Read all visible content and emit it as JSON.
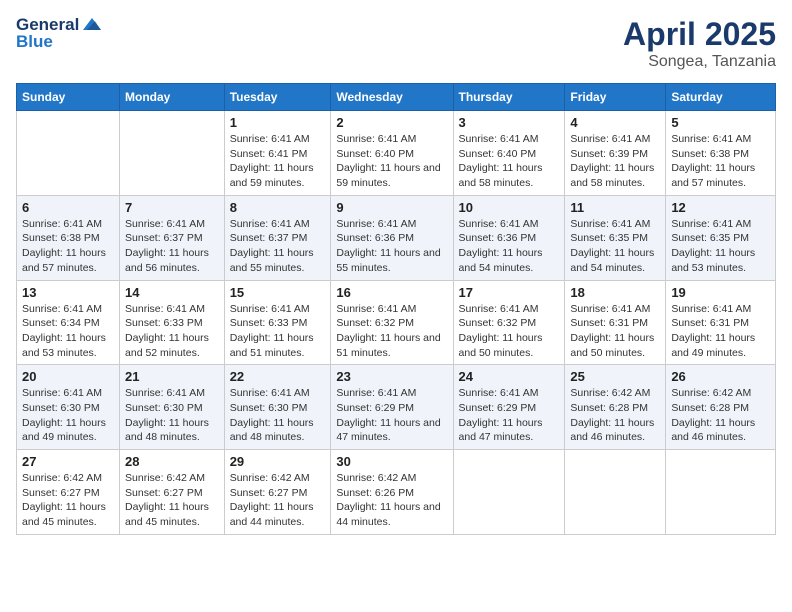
{
  "header": {
    "logo_general": "General",
    "logo_blue": "Blue",
    "title": "April 2025",
    "subtitle": "Songea, Tanzania"
  },
  "days_of_week": [
    "Sunday",
    "Monday",
    "Tuesday",
    "Wednesday",
    "Thursday",
    "Friday",
    "Saturday"
  ],
  "weeks": [
    [
      {
        "day": "",
        "info": ""
      },
      {
        "day": "",
        "info": ""
      },
      {
        "day": "1",
        "info": "Sunrise: 6:41 AM\nSunset: 6:41 PM\nDaylight: 11 hours and 59 minutes."
      },
      {
        "day": "2",
        "info": "Sunrise: 6:41 AM\nSunset: 6:40 PM\nDaylight: 11 hours and 59 minutes."
      },
      {
        "day": "3",
        "info": "Sunrise: 6:41 AM\nSunset: 6:40 PM\nDaylight: 11 hours and 58 minutes."
      },
      {
        "day": "4",
        "info": "Sunrise: 6:41 AM\nSunset: 6:39 PM\nDaylight: 11 hours and 58 minutes."
      },
      {
        "day": "5",
        "info": "Sunrise: 6:41 AM\nSunset: 6:38 PM\nDaylight: 11 hours and 57 minutes."
      }
    ],
    [
      {
        "day": "6",
        "info": "Sunrise: 6:41 AM\nSunset: 6:38 PM\nDaylight: 11 hours and 57 minutes."
      },
      {
        "day": "7",
        "info": "Sunrise: 6:41 AM\nSunset: 6:37 PM\nDaylight: 11 hours and 56 minutes."
      },
      {
        "day": "8",
        "info": "Sunrise: 6:41 AM\nSunset: 6:37 PM\nDaylight: 11 hours and 55 minutes."
      },
      {
        "day": "9",
        "info": "Sunrise: 6:41 AM\nSunset: 6:36 PM\nDaylight: 11 hours and 55 minutes."
      },
      {
        "day": "10",
        "info": "Sunrise: 6:41 AM\nSunset: 6:36 PM\nDaylight: 11 hours and 54 minutes."
      },
      {
        "day": "11",
        "info": "Sunrise: 6:41 AM\nSunset: 6:35 PM\nDaylight: 11 hours and 54 minutes."
      },
      {
        "day": "12",
        "info": "Sunrise: 6:41 AM\nSunset: 6:35 PM\nDaylight: 11 hours and 53 minutes."
      }
    ],
    [
      {
        "day": "13",
        "info": "Sunrise: 6:41 AM\nSunset: 6:34 PM\nDaylight: 11 hours and 53 minutes."
      },
      {
        "day": "14",
        "info": "Sunrise: 6:41 AM\nSunset: 6:33 PM\nDaylight: 11 hours and 52 minutes."
      },
      {
        "day": "15",
        "info": "Sunrise: 6:41 AM\nSunset: 6:33 PM\nDaylight: 11 hours and 51 minutes."
      },
      {
        "day": "16",
        "info": "Sunrise: 6:41 AM\nSunset: 6:32 PM\nDaylight: 11 hours and 51 minutes."
      },
      {
        "day": "17",
        "info": "Sunrise: 6:41 AM\nSunset: 6:32 PM\nDaylight: 11 hours and 50 minutes."
      },
      {
        "day": "18",
        "info": "Sunrise: 6:41 AM\nSunset: 6:31 PM\nDaylight: 11 hours and 50 minutes."
      },
      {
        "day": "19",
        "info": "Sunrise: 6:41 AM\nSunset: 6:31 PM\nDaylight: 11 hours and 49 minutes."
      }
    ],
    [
      {
        "day": "20",
        "info": "Sunrise: 6:41 AM\nSunset: 6:30 PM\nDaylight: 11 hours and 49 minutes."
      },
      {
        "day": "21",
        "info": "Sunrise: 6:41 AM\nSunset: 6:30 PM\nDaylight: 11 hours and 48 minutes."
      },
      {
        "day": "22",
        "info": "Sunrise: 6:41 AM\nSunset: 6:30 PM\nDaylight: 11 hours and 48 minutes."
      },
      {
        "day": "23",
        "info": "Sunrise: 6:41 AM\nSunset: 6:29 PM\nDaylight: 11 hours and 47 minutes."
      },
      {
        "day": "24",
        "info": "Sunrise: 6:41 AM\nSunset: 6:29 PM\nDaylight: 11 hours and 47 minutes."
      },
      {
        "day": "25",
        "info": "Sunrise: 6:42 AM\nSunset: 6:28 PM\nDaylight: 11 hours and 46 minutes."
      },
      {
        "day": "26",
        "info": "Sunrise: 6:42 AM\nSunset: 6:28 PM\nDaylight: 11 hours and 46 minutes."
      }
    ],
    [
      {
        "day": "27",
        "info": "Sunrise: 6:42 AM\nSunset: 6:27 PM\nDaylight: 11 hours and 45 minutes."
      },
      {
        "day": "28",
        "info": "Sunrise: 6:42 AM\nSunset: 6:27 PM\nDaylight: 11 hours and 45 minutes."
      },
      {
        "day": "29",
        "info": "Sunrise: 6:42 AM\nSunset: 6:27 PM\nDaylight: 11 hours and 44 minutes."
      },
      {
        "day": "30",
        "info": "Sunrise: 6:42 AM\nSunset: 6:26 PM\nDaylight: 11 hours and 44 minutes."
      },
      {
        "day": "",
        "info": ""
      },
      {
        "day": "",
        "info": ""
      },
      {
        "day": "",
        "info": ""
      }
    ]
  ]
}
